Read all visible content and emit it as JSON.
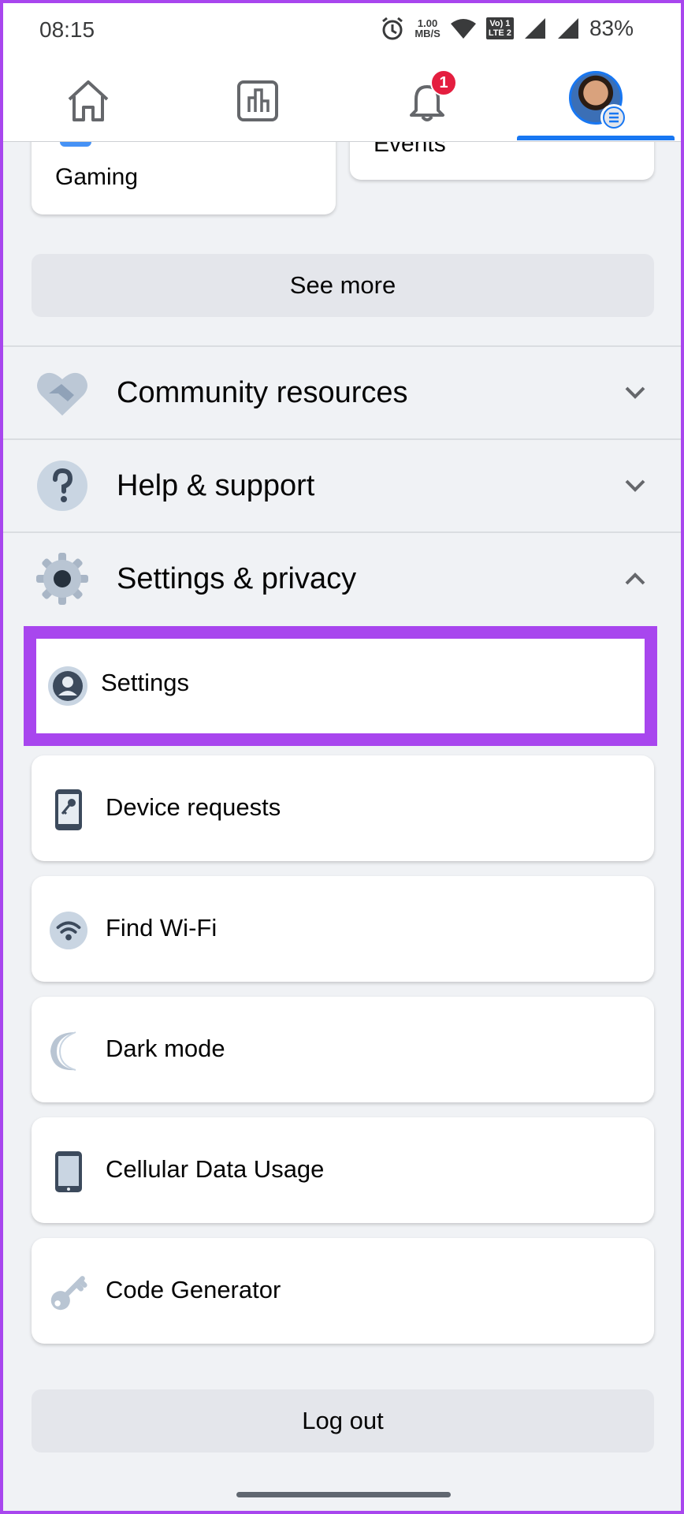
{
  "status_bar": {
    "time": "08:15",
    "net_speed_value": "1.00",
    "net_speed_unit": "MB/S",
    "volte_top": "Vo) 1",
    "volte_bottom": "LTE 2",
    "battery": "83%"
  },
  "nav": {
    "tabs": [
      "home",
      "feeds",
      "notifications",
      "menu"
    ],
    "notification_count": "1",
    "active_tab": "menu",
    "active_color": "#1877f2"
  },
  "shortcuts": {
    "left_label": "Gaming",
    "right_label": "Events"
  },
  "see_more_label": "See more",
  "sections": [
    {
      "label": "Community resources",
      "icon": "handshake-icon",
      "expanded": false
    },
    {
      "label": "Help & support",
      "icon": "question-icon",
      "expanded": false
    },
    {
      "label": "Settings & privacy",
      "icon": "gear-icon",
      "expanded": true
    }
  ],
  "settings_items": [
    {
      "label": "Settings",
      "icon": "profile-icon",
      "highlighted": true
    },
    {
      "label": "Device requests",
      "icon": "phone-key-icon"
    },
    {
      "label": "Find Wi-Fi",
      "icon": "wifi-icon"
    },
    {
      "label": "Dark mode",
      "icon": "moon-icon"
    },
    {
      "label": "Cellular Data Usage",
      "icon": "phone-icon"
    },
    {
      "label": "Code Generator",
      "icon": "key-icon"
    }
  ],
  "logout_label": "Log out",
  "highlight_color": "#a846ee"
}
